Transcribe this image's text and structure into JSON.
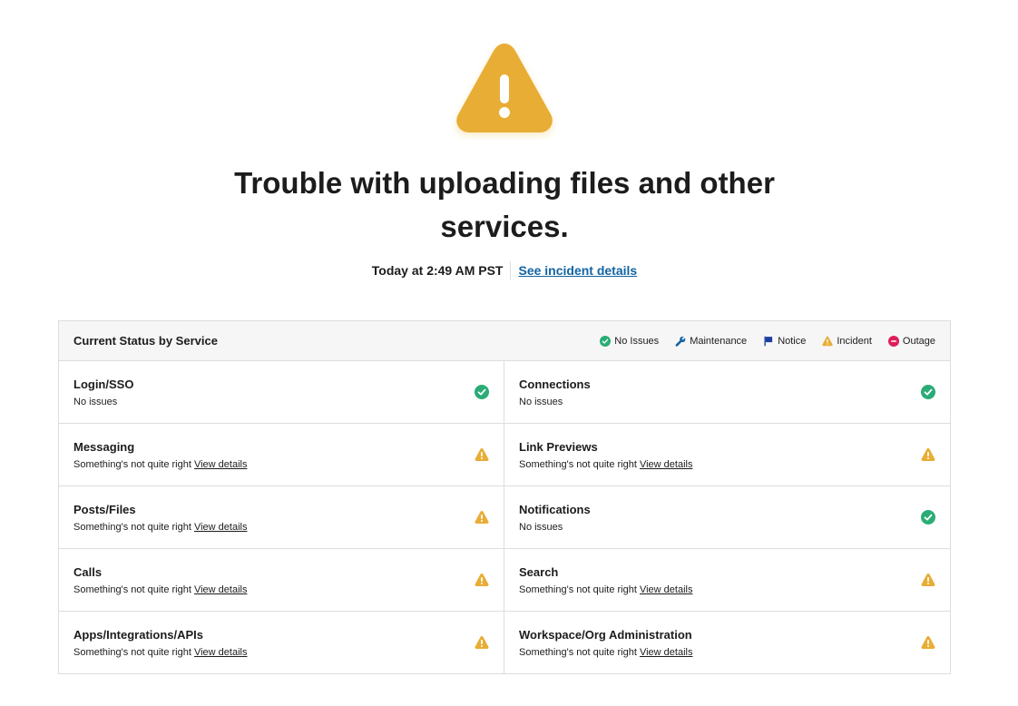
{
  "hero": {
    "title": "Trouble with uploading files and other services.",
    "time": "Today at 2:49 AM PST",
    "link": "See incident details",
    "icon": "warning-icon",
    "icon_color": "#e8ad35"
  },
  "table": {
    "title": "Current Status by Service",
    "legend": [
      {
        "label": "No Issues",
        "icon": "check-circle-icon",
        "color": "#2bac76"
      },
      {
        "label": "Maintenance",
        "icon": "wrench-icon",
        "color": "#1264a3"
      },
      {
        "label": "Notice",
        "icon": "flag-icon",
        "color": "#1d3e9e"
      },
      {
        "label": "Incident",
        "icon": "warning-icon",
        "color": "#e8ad35"
      },
      {
        "label": "Outage",
        "icon": "minus-circle-icon",
        "color": "#e01e5a"
      }
    ],
    "rows": [
      [
        {
          "name": "Login/SSO",
          "desc": "No issues",
          "link": "",
          "status": "ok"
        },
        {
          "name": "Connections",
          "desc": "No issues",
          "link": "",
          "status": "ok"
        }
      ],
      [
        {
          "name": "Messaging",
          "desc": "Something's not quite right",
          "link": "View details",
          "status": "incident"
        },
        {
          "name": "Link Previews",
          "desc": "Something's not quite right",
          "link": "View details",
          "status": "incident"
        }
      ],
      [
        {
          "name": "Posts/Files",
          "desc": "Something's not quite right",
          "link": "View details",
          "status": "incident"
        },
        {
          "name": "Notifications",
          "desc": "No issues",
          "link": "",
          "status": "ok"
        }
      ],
      [
        {
          "name": "Calls",
          "desc": "Something's not quite right",
          "link": "View details",
          "status": "incident"
        },
        {
          "name": "Search",
          "desc": "Something's not quite right",
          "link": "View details",
          "status": "incident"
        }
      ],
      [
        {
          "name": "Apps/Integrations/APIs",
          "desc": "Something's not quite right",
          "link": "View details",
          "status": "incident"
        },
        {
          "name": "Workspace/Org Administration",
          "desc": "Something's not quite right",
          "link": "View details",
          "status": "incident"
        }
      ]
    ]
  }
}
